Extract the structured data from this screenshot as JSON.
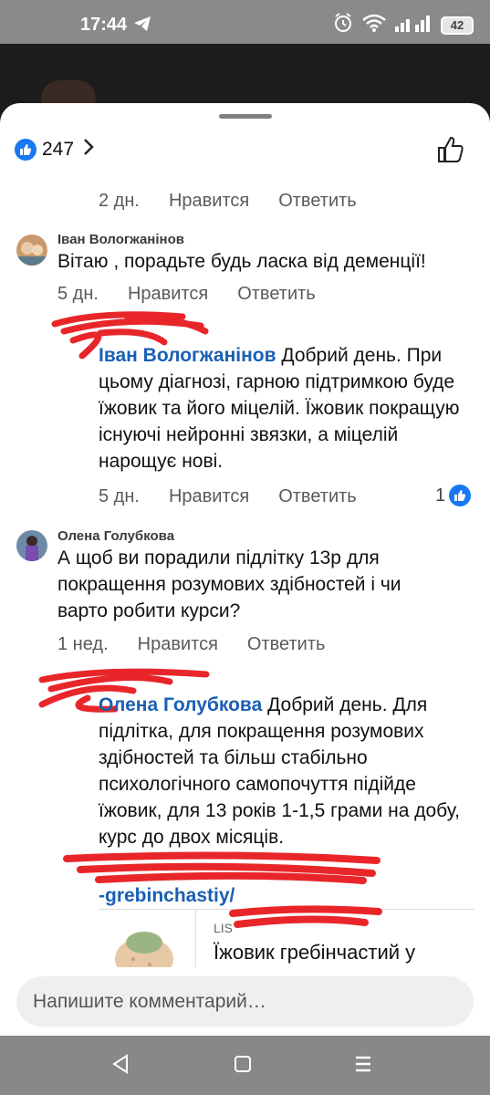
{
  "status_bar": {
    "time": "17:44",
    "battery": "42"
  },
  "reactions": {
    "count": "247"
  },
  "actions": {
    "like": "Нравится",
    "reply": "Ответить"
  },
  "thread": [
    {
      "kind": "action-row",
      "time": "2 дн."
    },
    {
      "kind": "comment",
      "author": "Іван Вологжанінов",
      "text": "Вітаю , порадьте будь ласка від деменції!",
      "time": "5 дн."
    },
    {
      "kind": "reply",
      "mention": "Іван Вологжанінов",
      "text": " Добрий день. При цьому діагнозі, гарною підтримкою буде їжовик та його міцелій. Їжовик покращую існуючі нейронні звязки, а міцелій нарощує нові.",
      "time": "5 дн.",
      "likes": "1"
    },
    {
      "kind": "comment",
      "author": "Олена Голубкова",
      "text": "А щоб ви порадили підлітку 13р для покращення розумових здібностей і чи варто робити курси?",
      "time": "1 нед."
    },
    {
      "kind": "reply",
      "mention": "Олена Голубкова",
      "text": " Добрий день. Для підлітка, для покращення розумових здібностей та більш стабільно психологічного самопочуття підійде їжовик, для 13 років 1-1,5 грами на добу, курс до двох місяців.",
      "link_tail": "-grebinchastiy/"
    }
  ],
  "preview": {
    "source": "LIS",
    "title": "Їжовик гребінчастий у"
  },
  "composer": {
    "placeholder": "Напишите комментарий…"
  },
  "colors": {
    "facebook_blue": "#1877f2",
    "mention_blue": "#1a5fb4",
    "redaction_red": "#e8262a"
  },
  "icons": {
    "telegram": "telegram-icon",
    "alarm": "alarm-icon",
    "wifi": "wifi-icon",
    "signal": "signal-icon",
    "like_reaction": "like-reaction-icon",
    "thumb": "thumbs-up-icon",
    "back": "back-nav-icon",
    "home": "home-nav-icon",
    "recents": "recents-nav-icon"
  }
}
